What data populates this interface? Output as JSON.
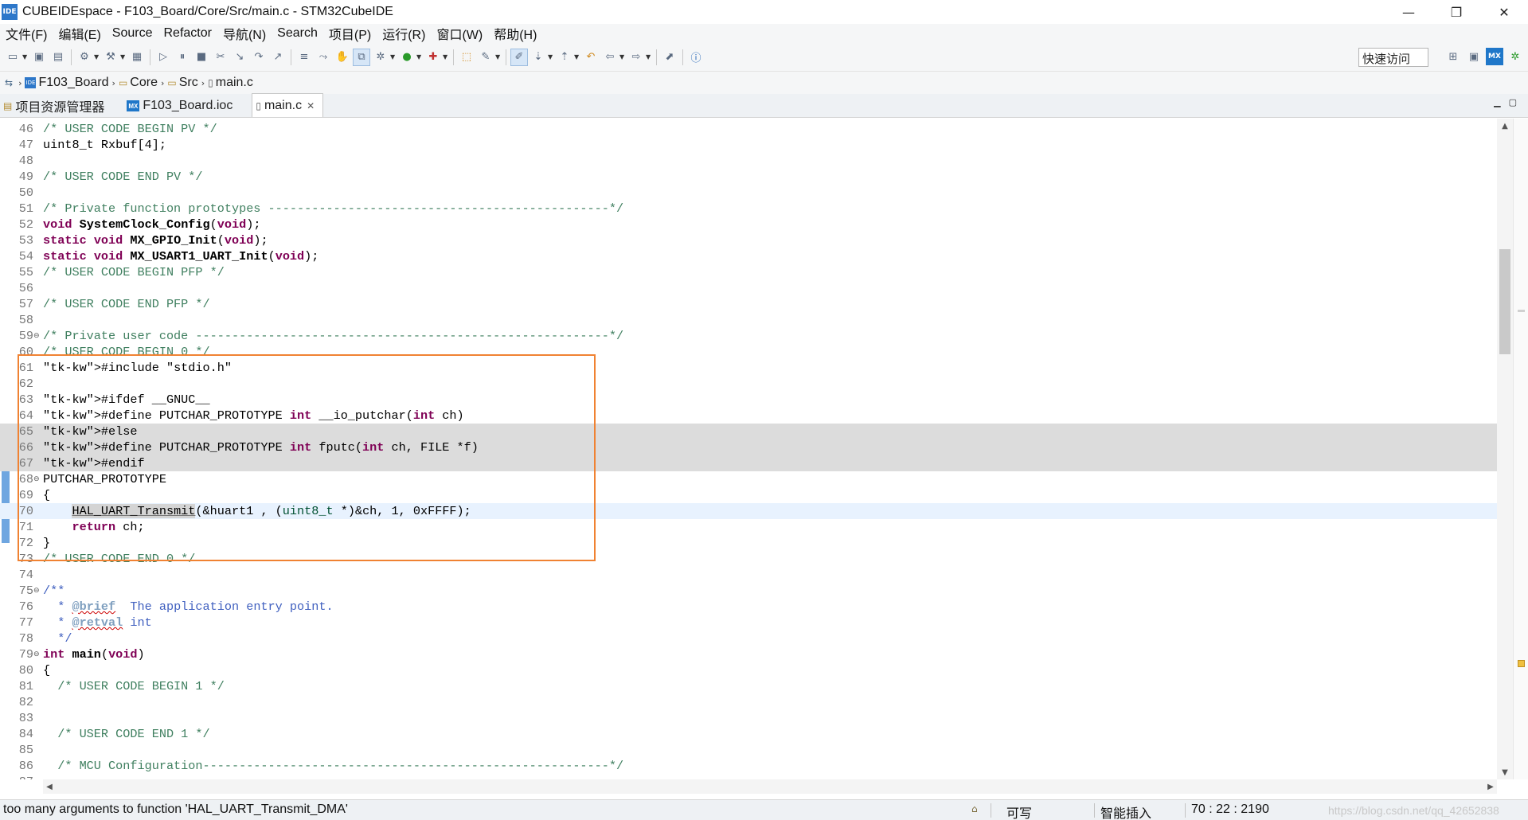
{
  "window": {
    "app_icon_text": "IDE",
    "title": "CUBEIDEspace - F103_Board/Core/Src/main.c - STM32CubeIDE",
    "minimize": "—",
    "maximize": "❐",
    "close": "✕"
  },
  "menu": [
    "文件(F)",
    "编辑(E)",
    "Source",
    "Refactor",
    "导航(N)",
    "Search",
    "项目(P)",
    "运行(R)",
    "窗口(W)",
    "帮助(H)"
  ],
  "toolbar": {
    "quick_access": "快速访问",
    "perspective_mx": "MX"
  },
  "breadcrumb": {
    "project_icon_text": "IDE",
    "items": [
      "F103_Board",
      "Core",
      "Src",
      "main.c"
    ]
  },
  "tabs": [
    {
      "label": "项目资源管理器",
      "active": false
    },
    {
      "label": "F103_Board.ioc",
      "icon_text": "MX",
      "active": false
    },
    {
      "label": "main.c",
      "active": true,
      "close": "✕"
    }
  ],
  "editor": {
    "lines": [
      {
        "num": "46",
        "text": "/* USER CODE BEGIN PV */"
      },
      {
        "num": "47",
        "text": "uint8_t Rxbuf[4];"
      },
      {
        "num": "48",
        "text": ""
      },
      {
        "num": "49",
        "text": "/* USER CODE END PV */"
      },
      {
        "num": "50",
        "text": ""
      },
      {
        "num": "51",
        "text": "/* Private function prototypes -----------------------------------------------*/"
      },
      {
        "num": "52",
        "text": "void SystemClock_Config(void);"
      },
      {
        "num": "53",
        "text": "static void MX_GPIO_Init(void);"
      },
      {
        "num": "54",
        "text": "static void MX_USART1_UART_Init(void);"
      },
      {
        "num": "55",
        "text": "/* USER CODE BEGIN PFP */"
      },
      {
        "num": "56",
        "text": ""
      },
      {
        "num": "57",
        "text": "/* USER CODE END PFP */"
      },
      {
        "num": "58",
        "text": ""
      },
      {
        "num": "59",
        "text": "/* Private user code ---------------------------------------------------------*/"
      },
      {
        "num": "60",
        "text": "/* USER CODE BEGIN 0 */"
      },
      {
        "num": "61",
        "text": "#include \"stdio.h\""
      },
      {
        "num": "62",
        "text": ""
      },
      {
        "num": "63",
        "text": "#ifdef __GNUC__"
      },
      {
        "num": "64",
        "text": "#define PUTCHAR_PROTOTYPE int __io_putchar(int ch)"
      },
      {
        "num": "65",
        "text": "#else"
      },
      {
        "num": "66",
        "text": "#define PUTCHAR_PROTOTYPE int fputc(int ch, FILE *f)"
      },
      {
        "num": "67",
        "text": "#endif"
      },
      {
        "num": "68",
        "text": "PUTCHAR_PROTOTYPE"
      },
      {
        "num": "69",
        "text": "{"
      },
      {
        "num": "70",
        "text": "    HAL_UART_Transmit(&huart1 , (uint8_t *)&ch, 1, 0xFFFF);"
      },
      {
        "num": "71",
        "text": "    return ch;"
      },
      {
        "num": "72",
        "text": "}"
      },
      {
        "num": "73",
        "text": "/* USER CODE END 0 */"
      },
      {
        "num": "74",
        "text": ""
      },
      {
        "num": "75",
        "text": "/**"
      },
      {
        "num": "76",
        "text": "  * @brief  The application entry point."
      },
      {
        "num": "77",
        "text": "  * @retval int"
      },
      {
        "num": "78",
        "text": "  */"
      },
      {
        "num": "79",
        "text": "int main(void)"
      },
      {
        "num": "80",
        "text": "{"
      },
      {
        "num": "81",
        "text": "  /* USER CODE BEGIN 1 */"
      },
      {
        "num": "82",
        "text": ""
      },
      {
        "num": "83",
        "text": ""
      },
      {
        "num": "84",
        "text": "  /* USER CODE END 1 */"
      },
      {
        "num": "85",
        "text": ""
      },
      {
        "num": "86",
        "text": "  /* MCU Configuration--------------------------------------------------------*/"
      },
      {
        "num": "87",
        "text": ""
      }
    ]
  },
  "status": {
    "message": "too many arguments to function 'HAL_UART_Transmit_DMA'",
    "writable": "可写",
    "insert_mode": "智能插入",
    "position": "70 : 22 : 2190",
    "watermark": "https://blog.csdn.net/qq_42652838"
  },
  "colors": {
    "highlight_box": "#f08232",
    "comment": "#3f7f5f",
    "keyword": "#7f0055",
    "string": "#2a00ff"
  }
}
